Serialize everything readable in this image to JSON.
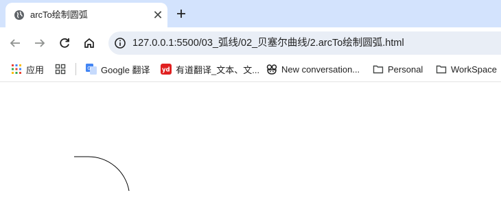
{
  "tab": {
    "title": "arcTo绘制圆弧",
    "close": "✕"
  },
  "address_bar": {
    "url": "127.0.0.1:5500/03_弧线/02_贝塞尔曲线/2.arcTo绘制圆弧.html"
  },
  "bookmarks": [
    {
      "label": "应用",
      "icon": "apps-grid-icon"
    },
    {
      "label": "",
      "icon": "tab-groups-icon"
    },
    {
      "label": "Google 翻译",
      "icon": "google-translate-icon"
    },
    {
      "label": "有道翻译_文本、文...",
      "icon": "youdao-icon"
    },
    {
      "label": "New conversation...",
      "icon": "copilot-icon"
    },
    {
      "label": "Personal",
      "icon": "folder-icon"
    },
    {
      "label": "WorkSpace",
      "icon": "folder-icon"
    }
  ],
  "canvas": {
    "shape": "arc"
  }
}
